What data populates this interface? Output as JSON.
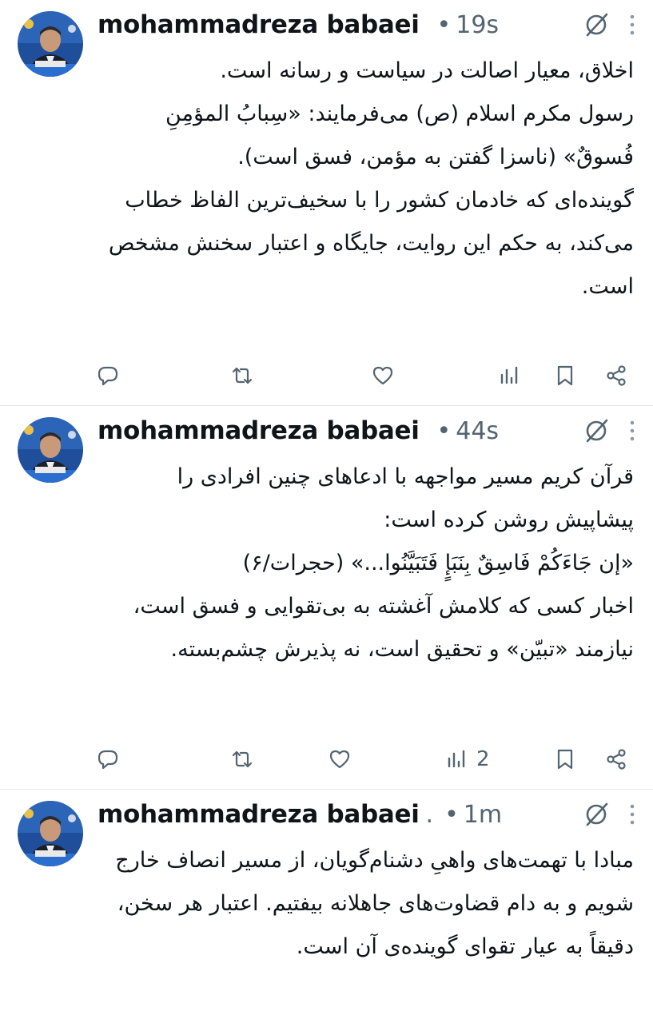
{
  "colors": {
    "text": "#0f1419",
    "muted": "#536471",
    "divider": "#e6e9ec",
    "background": "#ffffff"
  },
  "icons": {
    "avatar": "profile-photo",
    "grok": "grok-icon",
    "more": "more-vertical-icon",
    "reply": "reply-icon",
    "retweet": "retweet-icon",
    "like": "heart-icon",
    "views": "views-chart-icon",
    "bookmark": "bookmark-icon",
    "share": "share-icon"
  },
  "posts": [
    {
      "author": "mohammadreza babaei",
      "author_suffix": "",
      "time": "19s",
      "lines": [
        "اخلاق، معیار اصالت در سیاست و رسانه است.",
        "رسول مکرم اسلام (ص) می‌فرمایند: «سِبابُ المؤمِنِ فُسوقٌ» (ناسزا گفتن به مؤمن، فسق است).",
        " گوینده‌ای که خادمان کشور را با سخیف‌ترین الفاظ خطاب می‌کند، به حکم این روایت، جایگاه و اعتبار سخنش مشخص است."
      ],
      "views_count": ""
    },
    {
      "author": "mohammadreza babaei",
      "author_suffix": "",
      "time": "44s",
      "lines": [
        "قرآن کریم مسیر مواجهه با ادعاهای چنین افرادی را پیشاپیش روشن کرده است:",
        "«إن جَاءَكُمْ فَاسِقٌ بِنَبَإٍ فَتَبَيَّنُوا...» (حجرات/۶)",
        " اخبار کسی که کلامش آغشته به بی‌تقوایی و فسق است، نیازمند «تبیّن» و تحقیق است، نه پذیرش چشم‌بسته."
      ],
      "views_count": "2"
    },
    {
      "author": "mohammadreza babaei",
      "author_suffix": ".",
      "time": "1m",
      "lines": [
        "مبادا با تهمت‌های واهیِ دشنام‌گویان، از مسیر انصاف خارج شویم و به دام قضاوت‌های جاهلانه بیفتیم. اعتبار هر سخن، دقیقاً به عیار تقوای گوینده‌ی آن است."
      ],
      "views_count": ""
    }
  ]
}
